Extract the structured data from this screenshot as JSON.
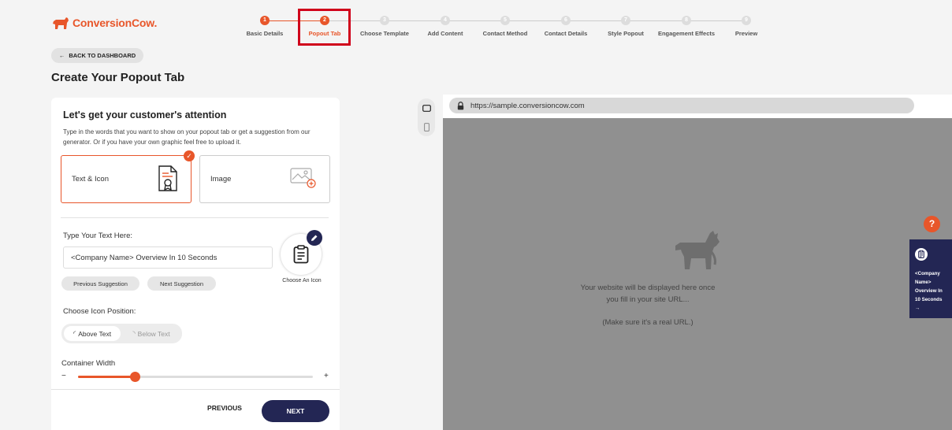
{
  "brand": {
    "name": "ConversionCow.",
    "accent": "#e8562a",
    "navy": "#232654"
  },
  "stepper": {
    "current": 2,
    "steps": [
      {
        "num": "1",
        "label": "Basic Details"
      },
      {
        "num": "2",
        "label": "Popout Tab"
      },
      {
        "num": "3",
        "label": "Choose Template"
      },
      {
        "num": "4",
        "label": "Add Content"
      },
      {
        "num": "5",
        "label": "Contact Method"
      },
      {
        "num": "6",
        "label": "Contact Details"
      },
      {
        "num": "7",
        "label": "Style Popout"
      },
      {
        "num": "8",
        "label": "Engagement Effects"
      },
      {
        "num": "9",
        "label": "Preview"
      }
    ]
  },
  "nav": {
    "back_label": "BACK TO DASHBOARD"
  },
  "page": {
    "title": "Create Your Popout Tab"
  },
  "form": {
    "heading": "Let's get your customer's attention",
    "description": "Type in the words that you want to show on your popout tab or get a suggestion from our generator. Or if you have your own graphic feel free to upload it.",
    "options": [
      {
        "label": "Text & Icon",
        "icon": "certificate-document-icon",
        "selected": true
      },
      {
        "label": "Image",
        "icon": "image-upload-icon",
        "selected": false
      }
    ],
    "text_label": "Type Your Text Here:",
    "text_value": "<Company Name> Overview In 10 Seconds",
    "prev_suggestion": "Previous Suggestion",
    "next_suggestion": "Next Suggestion",
    "choose_icon_label": "Choose An Icon",
    "selected_icon": "clipboard-icon",
    "icon_position_label": "Choose Icon Position:",
    "icon_position_options": [
      "Above Text",
      "Below Text"
    ],
    "icon_position_selected": "Above Text",
    "container_width_label": "Container Width",
    "slider_min_symbol": "−",
    "slider_max_symbol": "+",
    "container_width_fraction": 0.24,
    "previous_label": "PREVIOUS",
    "next_label": "NEXT"
  },
  "preview": {
    "url": "https://sample.conversioncow.com",
    "message_line1": "Your website will be displayed here once",
    "message_line2": "you fill in your site URL...",
    "message_note": "(Make sure it's a real URL.)",
    "help_symbol": "?",
    "tab_text": "<Company Name> Overview In 10 Seconds",
    "tab_arrow": "→"
  }
}
